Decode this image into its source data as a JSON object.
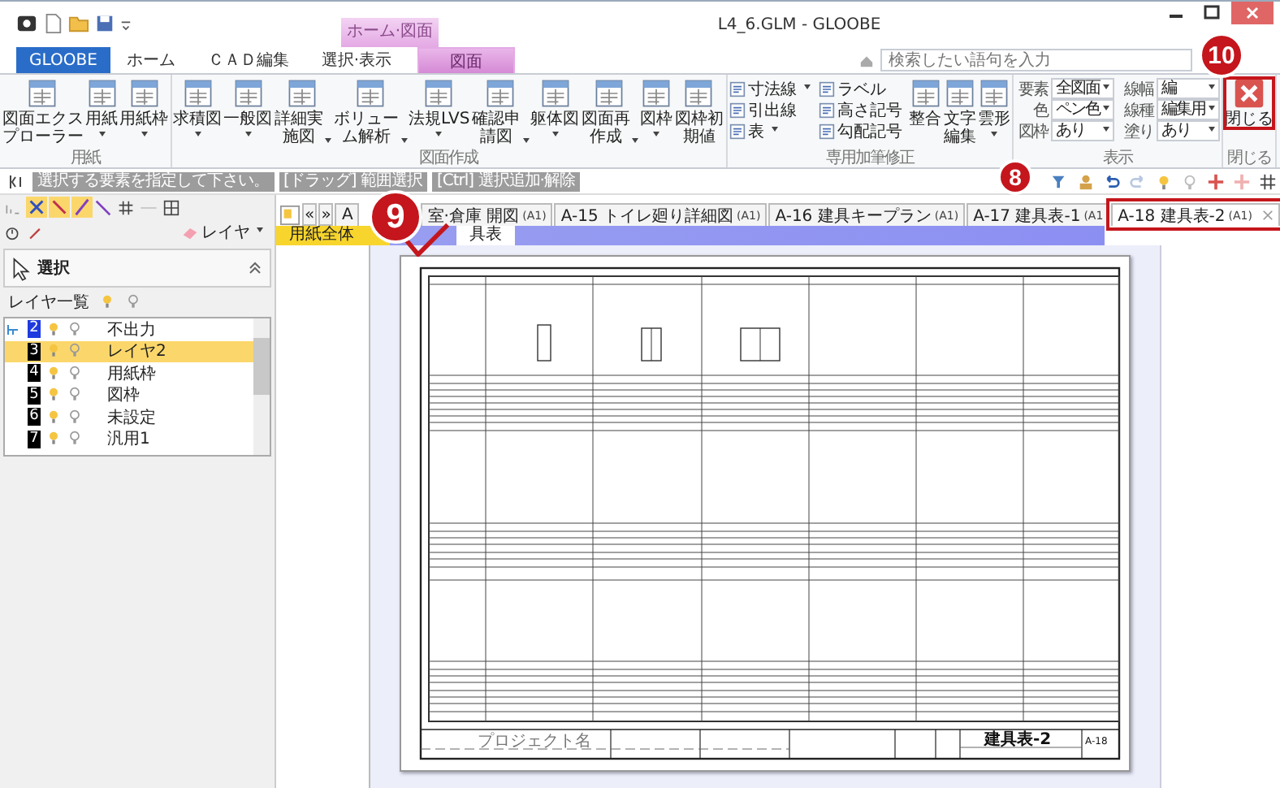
{
  "title_bar": {
    "title": "L4_6.GLM - GLOOBE",
    "context_tab_group": "ホーム·図面"
  },
  "ribbon_tabs": [
    {
      "label": "GLOOBE",
      "kind": "file",
      "selected": false
    },
    {
      "label": "ホーム",
      "kind": "tab",
      "selected": false
    },
    {
      "label": "ＣＡＤ編集",
      "kind": "tab",
      "selected": false
    },
    {
      "label": "選択·表示",
      "kind": "tab",
      "selected": false
    },
    {
      "label": "図面",
      "kind": "context",
      "selected": true
    }
  ],
  "search": {
    "placeholder": "検索したい語句を入力"
  },
  "ribbon_groups": [
    {
      "label": "用紙",
      "kind": "buttons",
      "items": [
        {
          "label": "図面エクスプローラー",
          "kind": "large",
          "dropdown": false
        },
        {
          "label": "用紙",
          "kind": "large",
          "dropdown": true
        },
        {
          "label": "用紙枠",
          "kind": "large",
          "dropdown": true
        }
      ]
    },
    {
      "label": "図面作成",
      "kind": "buttons",
      "items": [
        {
          "label": "求積図",
          "kind": "large",
          "dropdown": true
        },
        {
          "label": "一般図",
          "kind": "large",
          "dropdown": true
        },
        {
          "label": "詳細実施図",
          "kind": "large",
          "dropdown": true
        },
        {
          "label": "ボリューム解析",
          "kind": "large",
          "dropdown": true
        },
        {
          "label": "法規LVS",
          "kind": "large",
          "dropdown": true
        },
        {
          "label": "確認申請図",
          "kind": "large",
          "dropdown": true
        },
        {
          "label": "躯体図",
          "kind": "large",
          "dropdown": true
        },
        {
          "label": "図面再作成",
          "kind": "large",
          "dropdown": true
        },
        {
          "label": "図枠",
          "kind": "large",
          "dropdown": true
        },
        {
          "label": "図枠初期値",
          "kind": "large",
          "dropdown": false
        }
      ]
    },
    {
      "label": "専用加筆修正",
      "kind": "buttons",
      "items": [
        {
          "label": "寸法線",
          "kind": "small",
          "dropdown": true
        },
        {
          "label": "引出線",
          "kind": "small",
          "dropdown": false
        },
        {
          "label": "表",
          "kind": "small",
          "dropdown": true
        },
        {
          "label": "ラベル",
          "kind": "small",
          "dropdown": false
        },
        {
          "label": "高さ記号",
          "kind": "small",
          "dropdown": false
        },
        {
          "label": "勾配記号",
          "kind": "small",
          "dropdown": false
        },
        {
          "label": "整合",
          "kind": "large",
          "dropdown": false
        },
        {
          "label": "文字編集",
          "kind": "large",
          "dropdown": false
        },
        {
          "label": "雲形",
          "kind": "large",
          "dropdown": true
        }
      ]
    },
    {
      "label": "表示",
      "kind": "fields",
      "items": [
        {
          "label": "要素",
          "value": "全図面"
        },
        {
          "label": "色",
          "value": "ペン色"
        },
        {
          "label": "図枠",
          "value": "あり"
        },
        {
          "label": "線幅",
          "value": "編"
        },
        {
          "label": "線種",
          "value": "編集用"
        },
        {
          "label": "塗り",
          "value": "あり"
        }
      ]
    },
    {
      "label": "閉じる",
      "kind": "buttons",
      "items": [
        {
          "label": "閉じる",
          "kind": "close"
        }
      ]
    }
  ],
  "hints": [
    "選択する要素を指定して下さい。",
    "[ドラッグ] 範囲選択",
    "[Ctrl] 選択追加·解除"
  ],
  "left_panel": {
    "layer_button": "レイヤ",
    "panel_title": "選択",
    "layer_list_label": "レイヤ一覧",
    "layers": [
      {
        "number": "2",
        "name": "不出力",
        "current": true,
        "selected": false
      },
      {
        "number": "3",
        "name": "レイヤ2",
        "current": false,
        "selected": true
      },
      {
        "number": "4",
        "name": "用紙枠",
        "current": false,
        "selected": false
      },
      {
        "number": "5",
        "name": "図枠",
        "current": false,
        "selected": false
      },
      {
        "number": "6",
        "name": "未設定",
        "current": false,
        "selected": false
      },
      {
        "number": "7",
        "name": "汎用1",
        "current": false,
        "selected": false
      }
    ]
  },
  "sheet_nav": [
    "«",
    "»"
  ],
  "sheet_tabs": [
    {
      "label": "A",
      "selected": false
    },
    {
      "label": "室·倉庫 開図",
      "size": "(A1)",
      "selected": false
    },
    {
      "label": "A-15 トイレ廻り詳細図",
      "size": "(A1)",
      "selected": false
    },
    {
      "label": "A-16 建具キープラン",
      "size": "(A1)",
      "selected": false
    },
    {
      "label": "A-17 建具表-1",
      "size": "(A1",
      "selected": false
    },
    {
      "label": "A-18 建具表-2",
      "size": "(A1)",
      "selected": true
    }
  ],
  "view_tabs": [
    {
      "label": "用紙全体",
      "selected": true
    },
    {
      "label": "具表",
      "selected": false
    }
  ],
  "sheet": {
    "project_label": "プロジェクト名",
    "sheet_title": "建具表-2",
    "sheet_number": "A-18"
  },
  "callouts": [
    {
      "number": "8"
    },
    {
      "number": "9"
    },
    {
      "number": "10"
    }
  ]
}
